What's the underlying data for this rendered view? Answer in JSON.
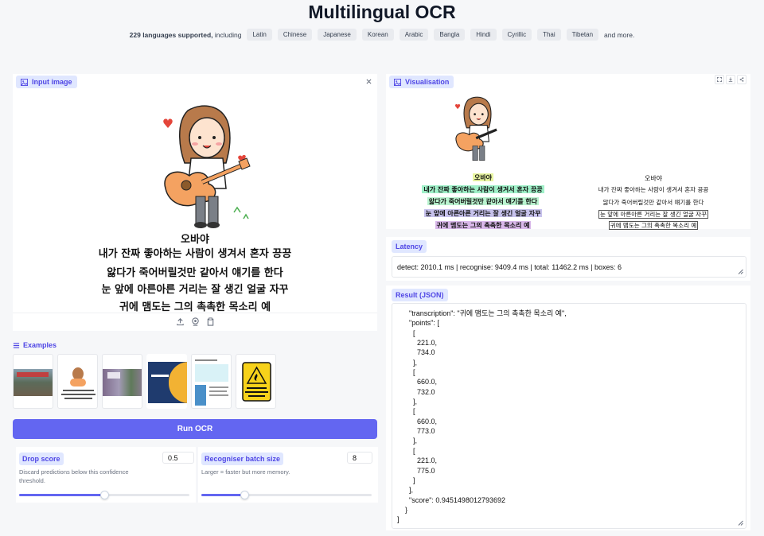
{
  "header": {
    "title": "Multilingual OCR",
    "lead_count": "229 languages supported,",
    "lead_rest": "including",
    "languages": [
      "Latin",
      "Chinese",
      "Japanese",
      "Korean",
      "Arabic",
      "Bangla",
      "Hindi",
      "Cyrillic",
      "Thai",
      "Tibetan"
    ],
    "trail": "and more."
  },
  "input_panel": {
    "label": "Input image",
    "image_text": [
      "오바야",
      "내가 잔짜 좋아하는 사람이 생겨서 혼자 끙끙",
      "앓다가 죽어버릴것만 같아서 얘기를 한다",
      "눈 앞에 아른아른 거리는 잘 생긴 얼굴 자꾸",
      "귀에 맴도는 그의 촉촉한 목소리 예"
    ]
  },
  "examples": {
    "label": "Examples"
  },
  "run_button": {
    "label": "Run OCR"
  },
  "drop_score": {
    "label": "Drop score",
    "value": "0.5",
    "description": "Discard predictions below this confidence threshold.",
    "fraction": 0.5
  },
  "batch_size": {
    "label": "Recogniser batch size",
    "value": "8",
    "description": "Larger = faster but more memory.",
    "fraction": 0.25
  },
  "visualisation": {
    "label": "Visualisation",
    "left_lines": [
      "오바야",
      "내가 잔짜 좋아하는 사람이 생겨서 혼자 끙끙",
      "앓다가 죽어버릴것만 같아서 얘기를 한다",
      "눈 앞에 아른아른 거리는 잘 생긴 얼굴 자꾸",
      "귀에 맴도는 그의 촉촉한 목소리 예"
    ],
    "right_lines": [
      "오바야",
      "내가 잔짜 좋아하는 사람이 생겨서 혼자 끙끙",
      "앓다가 죽어버릴것만 같아서 얘기를 한다",
      "눈 앞에 아른아른 거리는 잘 생긴 얼굴 자꾸",
      "귀에 맴도는 그의 촉촉한 목소리 예"
    ],
    "highlight_colors": [
      "#e8f5a0",
      "#9ff0c8",
      "#b9f3cf",
      "#c7c2ec",
      "#d9b8ea"
    ]
  },
  "latency": {
    "label": "Latency",
    "value": "detect: 2010.1 ms | recognise: 9409.4 ms | total: 11462.2 ms | boxes: 6"
  },
  "result": {
    "label": "Result (JSON)",
    "text": "      \"transcription\": \"귀에 맴도는 그의 촉촉한 목소리 예\",\n      \"points\": [\n        [\n          221.0,\n          734.0\n        ],\n        [\n          660.0,\n          732.0\n        ],\n        [\n          660.0,\n          773.0\n        ],\n        [\n          221.0,\n          775.0\n        ]\n      ],\n      \"score\": 0.9451498012793692\n    }\n]"
  },
  "colors": {
    "accent": "#6366f1",
    "chip_bg": "#e0e7ff",
    "chip_text": "#4f46e5"
  }
}
